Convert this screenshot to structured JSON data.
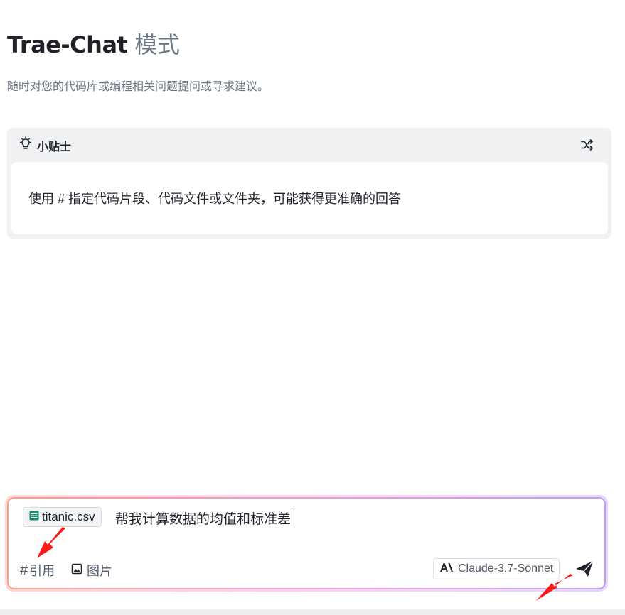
{
  "header": {
    "title": "Trae-Chat",
    "mode": "模式",
    "subtitle": "随时对您的代码库或编程相关问题提问或寻求建议。"
  },
  "tip": {
    "icon": "lightbulb-icon",
    "title": "小贴士",
    "shuffle_icon": "shuffle-icon",
    "text": "使用 # 指定代码片段、代码文件或文件夹，可能获得更准确的回答"
  },
  "composer": {
    "attachment": {
      "icon": "spreadsheet-icon",
      "icon_color": "#1a8a6e",
      "name": "titanic.csv"
    },
    "input_value": "帮我计算数据的均值和标准差",
    "toolbar": {
      "reference_symbol": "#",
      "reference_label": "引用",
      "image_label": "图片",
      "model": "Claude-3.7-Sonnet",
      "send_icon": "send-icon"
    },
    "border_gradient": [
      "#f6a08f",
      "#f19ad6",
      "#b9a2f7"
    ]
  },
  "annotations": {
    "arrow_color": "#ff1a1a"
  }
}
